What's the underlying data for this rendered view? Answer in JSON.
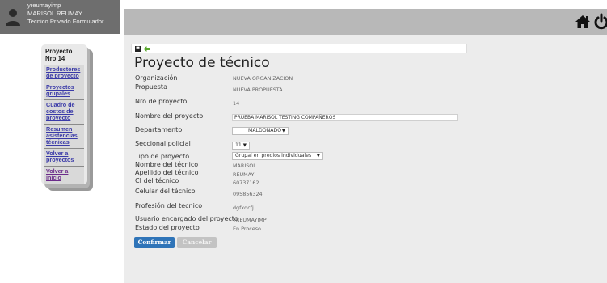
{
  "user": {
    "username": "yreumayimp",
    "fullname": "MARISOL REUMAY",
    "role": "Tecnico Privado Formulador"
  },
  "icons": {
    "avatar": "user-silhouette",
    "home": "home-icon",
    "power": "power-icon",
    "save": "floppy-disk-icon",
    "back": "arrow-left-icon"
  },
  "colors": {
    "primary_button": "#2f74b8",
    "link": "#3a3aa8",
    "back_arrow": "#5aa82e"
  },
  "sidebar": {
    "title_line1": "Proyecto",
    "title_line2": "Nro 14",
    "links": [
      "Productores de proyecto",
      "Proyectos grupales",
      "Cuadro de costos de proyecto",
      "Resumen asistencias técnicas",
      "Volver a proyectos",
      "Volver a inicio"
    ]
  },
  "page": {
    "title": "Proyecto de técnico"
  },
  "fields": {
    "organizacion_label": "Organización",
    "organizacion_value": "NUEVA ORGANIZACION",
    "propuesta_label": "Propuesta",
    "propuesta_value": "NUEVA PROPUESTA",
    "nro_label": "Nro de proyecto",
    "nro_value": "14",
    "nombre_label": "Nombre del proyecto",
    "nombre_value": "PRUEBA MARISOL TESTING COMPAÑEROS",
    "departamento_label": "Departamento",
    "departamento_value": "MALDONADO",
    "seccional_label": "Seccional policial",
    "seccional_value": "11",
    "tipo_label": "Tipo de proyecto",
    "tipo_value": "Grupal en predios individuales",
    "nombre_tecnico_label": "Nombre del técnico",
    "nombre_tecnico_value": "MARISOL",
    "apellido_label": "Apellido del técnico",
    "apellido_value": "REUMAY",
    "ci_label": "CI del técnico",
    "ci_value": "60737162",
    "celular_label": "Celular del técnico",
    "celular_value": "095856324",
    "profesion_label": "Profesión del tecnico",
    "profesion_value": "dgfxdcfj",
    "usuario_label": "Usuario encargado del proyecto",
    "usuario_value": "YREUMAYIMP",
    "estado_label": "Estado del proyecto",
    "estado_value": "En Proceso"
  },
  "buttons": {
    "confirm": "Confirmar",
    "cancel": "Cancelar"
  }
}
